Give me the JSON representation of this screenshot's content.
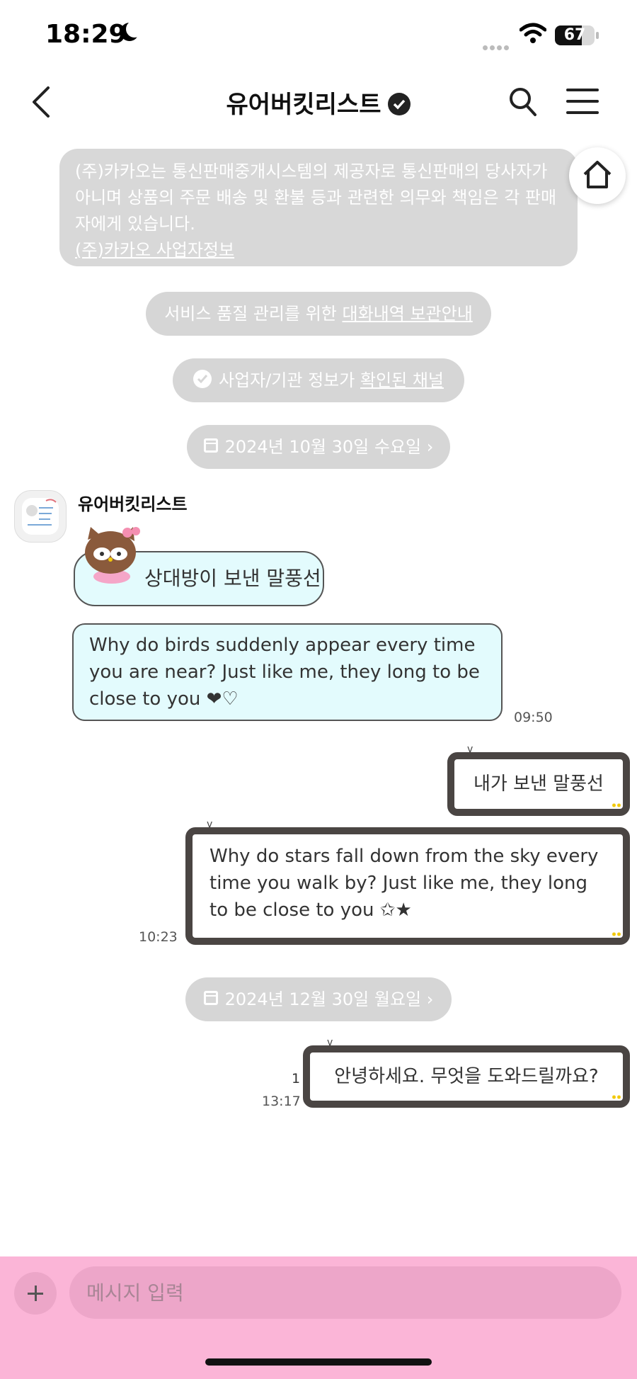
{
  "status_bar": {
    "time": "18:29",
    "battery": "67",
    "battery_level": 0.67
  },
  "header": {
    "title": "유어버킷리스트"
  },
  "notice": {
    "text": "(주)카카오는 통신판매중개시스템의 제공자로 통신판매의 당사자가 아니며 상품의 주문 배송 및 환불 등과 관련한 의무와 책임은 각 판매자에게 있습니다.",
    "link": "(주)카카오 사업자정보"
  },
  "service_notice": {
    "prefix": "서비스 품질 관리를 위한 ",
    "link": "대화내역 보관안내"
  },
  "verified_notice": {
    "prefix": "사업자/기관 정보가 ",
    "link": "확인된 채널"
  },
  "dates": [
    "2024년 10월 30일 수요일",
    "2024년 12월 30일 월요일"
  ],
  "sender": {
    "name": "유어버킷리스트"
  },
  "messages": [
    {
      "text": "상대방이 보낸 말풍선"
    },
    {
      "text": "Why do birds suddenly appear every time you are near? Just like me, they long to be close to you ❤♡",
      "time": "09:50"
    },
    {
      "text": "내가 보낸 말풍선"
    },
    {
      "text": "Why do stars fall down from the sky every time you walk by? Just like me, they long to be close to you ✩★",
      "time": "10:23"
    },
    {
      "text": "안녕하세요. 무엇을 도와드릴까요?",
      "time": "13:17",
      "unread": "1"
    }
  ],
  "input": {
    "placeholder": "메시지 입력"
  },
  "colors": {
    "input_bar": "#fbb5d7",
    "incoming_bubble": "#e3fbfd",
    "outgoing_border": "#4a4543",
    "system_pill": "#d6d6d6"
  },
  "icons": [
    "back-icon",
    "verified-icon",
    "search-icon",
    "menu-icon",
    "home-icon",
    "calendar-icon",
    "plus-icon"
  ]
}
